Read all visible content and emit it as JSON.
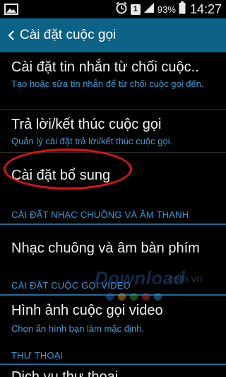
{
  "status_bar": {
    "sim_badge": "1",
    "battery": "93%",
    "time": "14:27",
    "icons": [
      "image-icon",
      "alarm-icon",
      "sim-icon",
      "signal-icon",
      "battery-icon"
    ]
  },
  "action_bar": {
    "title": "Cài đặt cuộc gọi",
    "back_icon": "chevron-left-icon",
    "color": "#0d6288"
  },
  "list": {
    "reject_messages": {
      "title": "Cài đặt tin nhắn từ chối cuộc..",
      "subtitle": "Tạo hoặc sửa tin nhắn để từ chối cuộc gọi đến."
    },
    "answer_end": {
      "title": "Trả lời/kết thúc cuộc gọi",
      "subtitle": "Quản lý cài đặt trả lời/kết thúc cuộc gọi."
    },
    "additional": {
      "title": "Cài đặt bổ sung"
    },
    "section_ringtone": "CÀI ĐẶT NHẠC CHUÔNG VÀ ÂM THANH",
    "ringtone": {
      "title": "Nhạc chuông và âm bàn phím"
    },
    "section_video": "CÀI ĐẶT CUỘC GỌI VIDEO",
    "video_image": {
      "title": "Hình ảnh cuộc gọi video",
      "subtitle": "Chọn ẩn hình bạn làm mặc định."
    },
    "section_voicemail": "THƯ THOẠI",
    "voicemail_partial": {
      "title": "Dịch vụ thư thoại"
    }
  },
  "watermark": {
    "text": "Download",
    "domain": ".com.vn",
    "dot_colors": [
      "#2a6fd6",
      "#e3a51c",
      "#3fae3f",
      "#d63a3a",
      "#2a9fd6"
    ]
  },
  "highlight_color": "#e30f1a"
}
